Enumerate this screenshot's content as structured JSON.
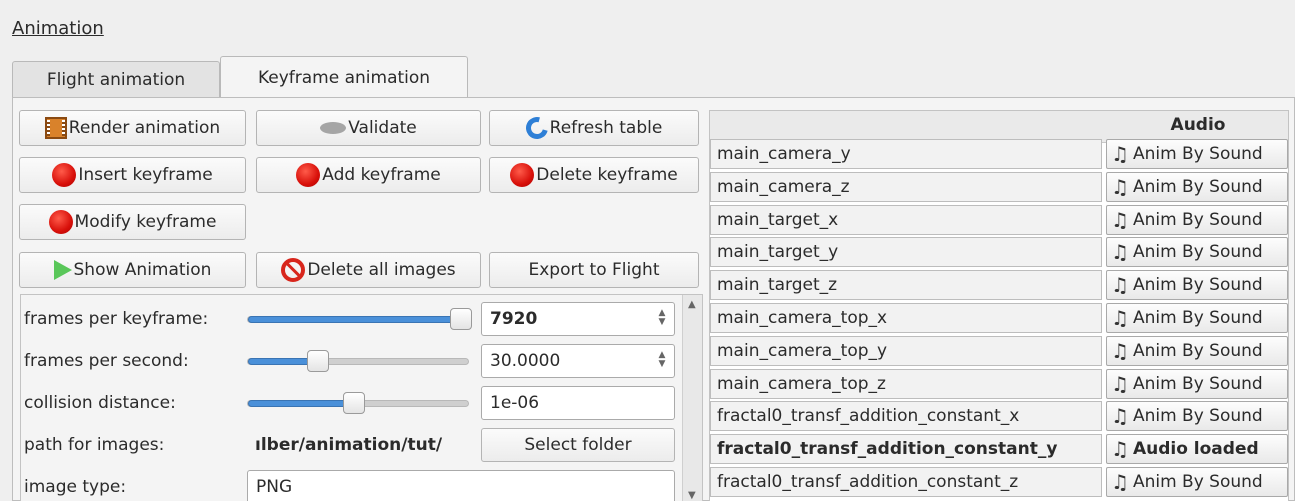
{
  "dock": {
    "title": "Animation"
  },
  "tabs": [
    {
      "label": "Flight animation"
    },
    {
      "label": "Keyframe animation"
    }
  ],
  "buttons": {
    "render": "Render animation",
    "validate": "Validate",
    "refresh": "Refresh table",
    "insert": "Insert keyframe",
    "add": "Add keyframe",
    "delete": "Delete keyframe",
    "modify": "Modify keyframe",
    "show": "Show Animation",
    "delete_images": "Delete all images",
    "export": "Export to Flight"
  },
  "params": {
    "frames_per_keyframe": {
      "label": "frames per keyframe:",
      "value": "7920",
      "slider": 0.97
    },
    "frames_per_second": {
      "label": "frames per second:",
      "value": "30.0000",
      "slider": 0.32
    },
    "collision_distance": {
      "label": "collision distance:",
      "value": "1e-06",
      "slider": 0.48
    },
    "path_for_images": {
      "label": "path for images:",
      "value": "ılber/animation/tut/",
      "button": "Select folder"
    },
    "image_type": {
      "label": "image type:",
      "value": "PNG"
    }
  },
  "table": {
    "header_audio": "Audio",
    "rows": [
      {
        "name": "main_camera_y",
        "audio": "Anim By Sound"
      },
      {
        "name": "main_camera_z",
        "audio": "Anim By Sound"
      },
      {
        "name": "main_target_x",
        "audio": "Anim By Sound"
      },
      {
        "name": "main_target_y",
        "audio": "Anim By Sound"
      },
      {
        "name": "main_target_z",
        "audio": "Anim By Sound"
      },
      {
        "name": "main_camera_top_x",
        "audio": "Anim By Sound"
      },
      {
        "name": "main_camera_top_y",
        "audio": "Anim By Sound"
      },
      {
        "name": "main_camera_top_z",
        "audio": "Anim By Sound"
      },
      {
        "name": "fractal0_transf_addition_constant_x",
        "audio": "Anim By Sound"
      },
      {
        "name": "fractal0_transf_addition_constant_y",
        "audio": "Audio loaded"
      },
      {
        "name": "fractal0_transf_addition_constant_z",
        "audio": "Anim By Sound"
      }
    ]
  }
}
